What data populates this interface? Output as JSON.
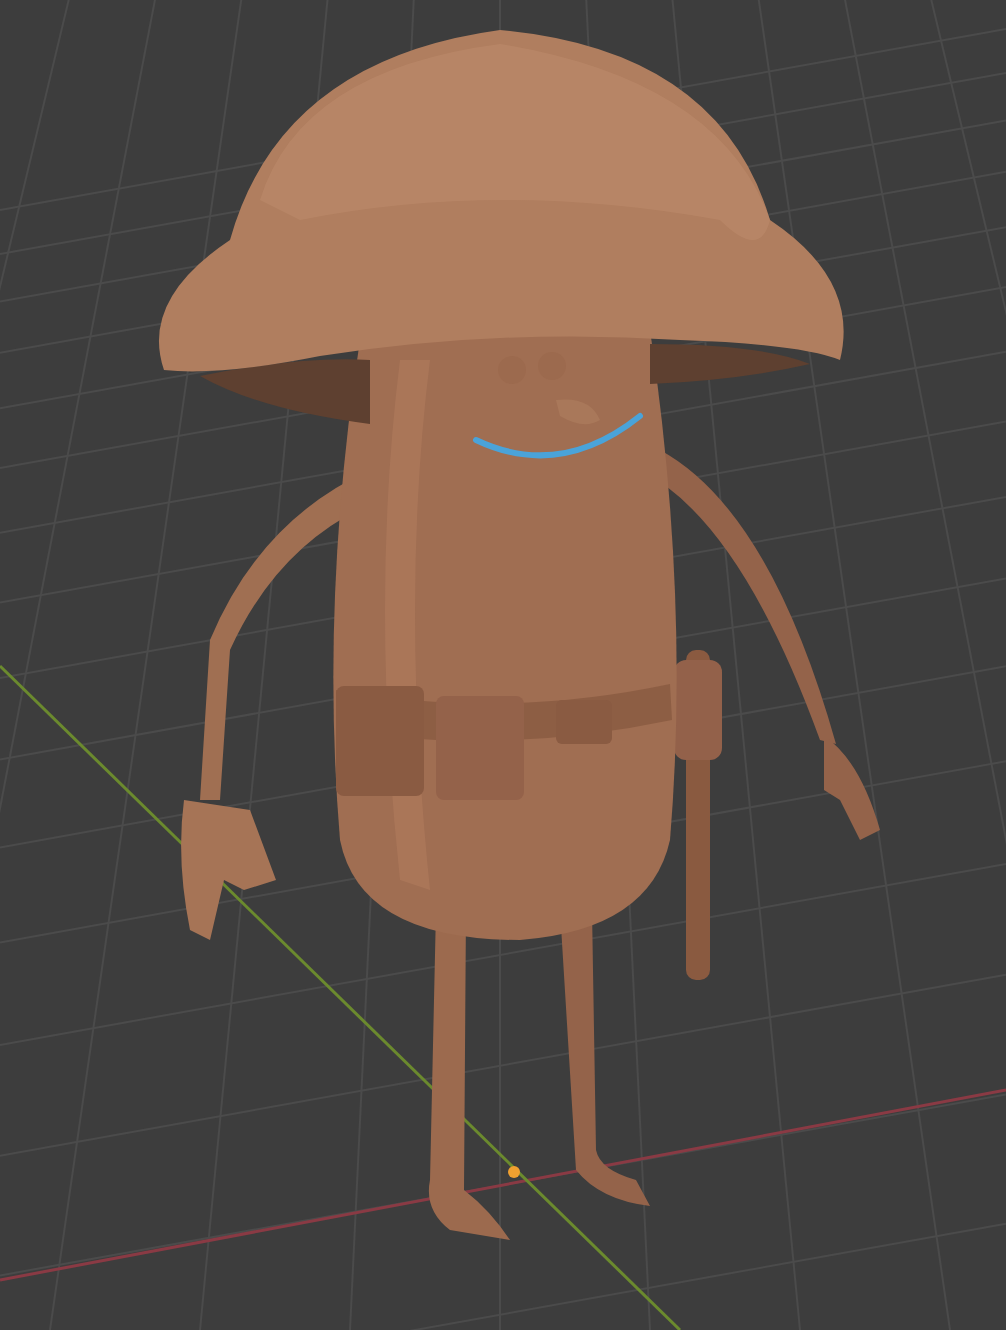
{
  "viewport": {
    "grid": true,
    "axis_lines": true,
    "origin_marker": true
  }
}
